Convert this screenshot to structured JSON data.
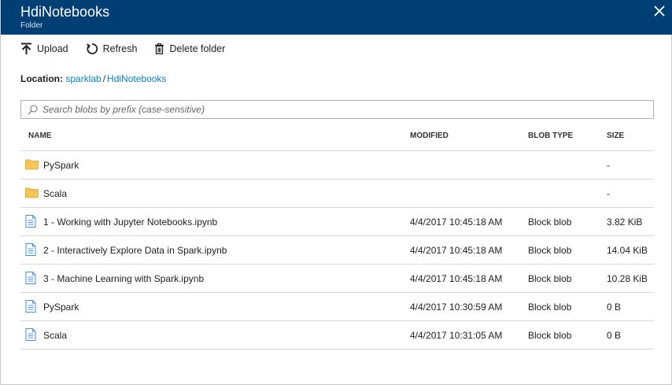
{
  "window": {
    "title": "HdiNotebooks",
    "subtitle": "Folder"
  },
  "toolbar": {
    "upload": "Upload",
    "refresh": "Refresh",
    "delete": "Delete folder"
  },
  "location": {
    "label": "Location:",
    "container": "sparklab",
    "separator": "/",
    "folder": "HdiNotebooks"
  },
  "search": {
    "placeholder": "Search blobs by prefix (case-sensitive)",
    "value": ""
  },
  "table": {
    "headers": {
      "name": "NAME",
      "modified": "MODIFIED",
      "blob_type": "BLOB TYPE",
      "size": "SIZE"
    },
    "rows": [
      {
        "icon": "folder-icon",
        "name": "PySpark",
        "modified": "",
        "blob_type": "",
        "size": "-"
      },
      {
        "icon": "folder-icon",
        "name": "Scala",
        "modified": "",
        "blob_type": "",
        "size": "-"
      },
      {
        "icon": "file-icon",
        "name": "1 - Working with Jupyter Notebooks.ipynb",
        "modified": "4/4/2017 10:45:18 AM",
        "blob_type": "Block blob",
        "size": "3.82 KiB"
      },
      {
        "icon": "file-icon",
        "name": "2 - Interactively Explore Data in Spark.ipynb",
        "modified": "4/4/2017 10:45:18 AM",
        "blob_type": "Block blob",
        "size": "14.04 KiB"
      },
      {
        "icon": "file-icon",
        "name": "3 - Machine Learning with Spark.ipynb",
        "modified": "4/4/2017 10:45:18 AM",
        "blob_type": "Block blob",
        "size": "10.28 KiB"
      },
      {
        "icon": "file-icon",
        "name": "PySpark",
        "modified": "4/4/2017 10:30:59 AM",
        "blob_type": "Block blob",
        "size": "0 B"
      },
      {
        "icon": "file-icon",
        "name": "Scala",
        "modified": "4/4/2017 10:31:05 AM",
        "blob_type": "Block blob",
        "size": "0 B"
      }
    ]
  },
  "colors": {
    "titlebar": "#003f73",
    "link": "#0a7fc4",
    "folder": "#f5c65a",
    "file": "#4a8fd0"
  }
}
